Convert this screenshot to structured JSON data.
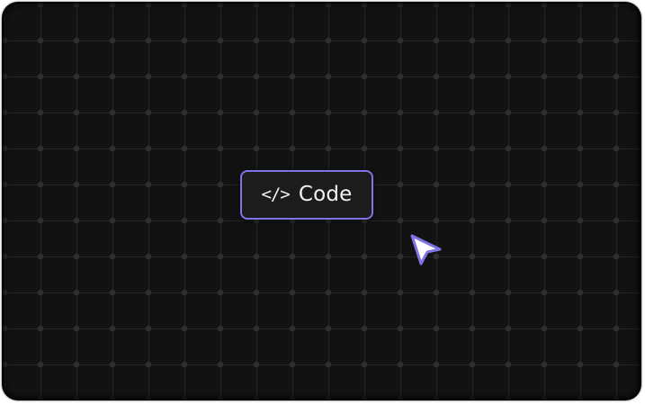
{
  "canvas": {
    "background_color": "#121212",
    "grid_line_color": "#242424",
    "grid_dot_color": "#2f2f2f"
  },
  "code_chip": {
    "icon": "code-brackets-icon",
    "icon_text": "</>",
    "label": "Code",
    "border_color": "#7f74e6"
  },
  "cursor": {
    "icon": "pointer-cursor-icon",
    "fill_color": "#ffffff",
    "outline_color": "#7f74e6"
  }
}
